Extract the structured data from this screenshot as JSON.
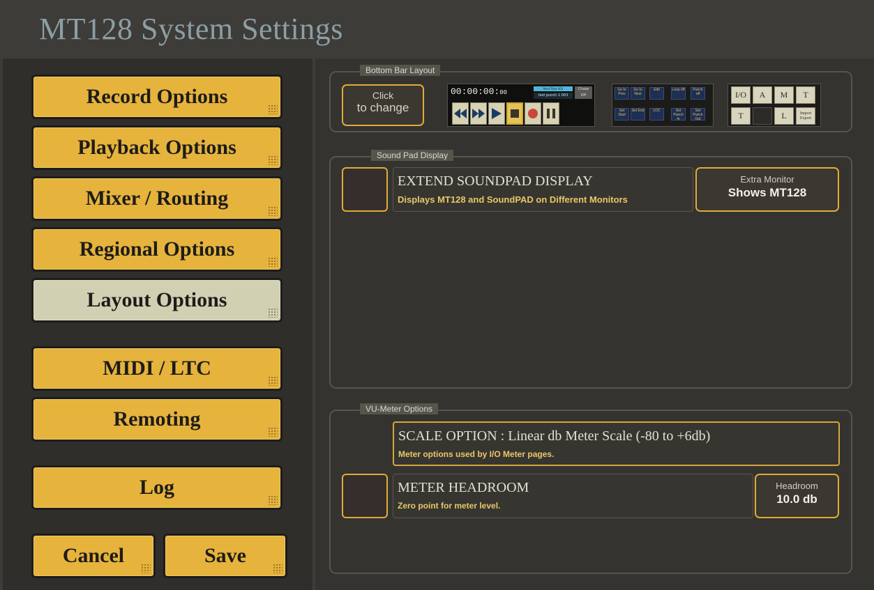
{
  "window": {
    "title": "MT128 System Settings"
  },
  "nav": {
    "items": [
      {
        "label": "Record Options"
      },
      {
        "label": "Playback Options"
      },
      {
        "label": "Mixer / Routing"
      },
      {
        "label": "Regional Options"
      },
      {
        "label": "Layout Options",
        "active": true
      },
      {
        "label": "MIDI / LTC"
      },
      {
        "label": "Remoting"
      },
      {
        "label": "Log"
      }
    ],
    "cancel_label": "Cancel",
    "save_label": "Save"
  },
  "bottom_bar": {
    "section_label": "Bottom Bar Layout",
    "click_line1": "Click",
    "click_line2": "to change",
    "preview": {
      "timecode_main": "00:00:00:",
      "timecode_frames": "00",
      "next_take": "Next Take 003",
      "test_punch": "test punch 1 003",
      "chase_label": "Chase",
      "chase_value": "Off",
      "transport_icons": [
        "rewind-icon",
        "fast-forward-icon",
        "play-icon",
        "stop-icon",
        "record-icon",
        "pause-icon"
      ]
    },
    "loc_grid": {
      "top": [
        "Go to Prev",
        "Go to Next",
        "Edit",
        "Loop off",
        "Punch off"
      ],
      "bottom": [
        "Set Start",
        "Set End",
        "LOC",
        "Set Punch In",
        "Set Punch Out"
      ]
    },
    "io_grid": {
      "top": [
        "I/O",
        "A",
        "M",
        "T"
      ],
      "bottom": [
        "T",
        "",
        "L",
        "Import Export"
      ]
    }
  },
  "sound_pad": {
    "section_label": "Sound Pad Display",
    "title": "EXTEND SOUNDPAD DISPLAY",
    "desc": "Displays MT128 and SoundPAD on Different Monitors",
    "monitor_caption": "Extra Monitor",
    "monitor_value": "Shows MT128"
  },
  "vu_meter": {
    "section_label": "VU-Meter Options",
    "scale_title": "SCALE OPTION : Linear db Meter Scale (-80 to +6db)",
    "scale_desc": "Meter options used by I/O Meter pages.",
    "headroom_title": "METER HEADROOM",
    "headroom_desc": "Zero point for meter level.",
    "headroom_caption": "Headroom",
    "headroom_value": "10.0 db"
  },
  "colors": {
    "button_gold": "#e6b33c",
    "button_active": "#d2d0b2",
    "accent_border": "#e0ac37",
    "desc_text": "#e8c86a",
    "background": "#3d3c38"
  }
}
